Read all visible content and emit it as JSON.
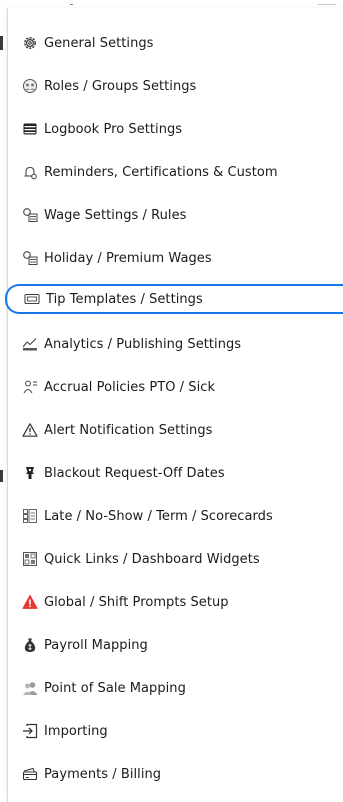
{
  "menu": {
    "items": [
      {
        "label": "General Settings",
        "icon": "gear-icon"
      },
      {
        "label": "Roles / Groups Settings",
        "icon": "group-globe-icon"
      },
      {
        "label": "Logbook Pro Settings",
        "icon": "logbook-icon"
      },
      {
        "label": "Reminders, Certifications & Custom",
        "icon": "bell-reminder-icon"
      },
      {
        "label": "Wage Settings / Rules",
        "icon": "wage-icon"
      },
      {
        "label": "Holiday / Premium Wages",
        "icon": "holiday-wage-icon"
      },
      {
        "label": "Tip Templates / Settings",
        "icon": "tip-card-icon",
        "selected": true
      },
      {
        "label": "Analytics / Publishing Settings",
        "icon": "analytics-chart-icon"
      },
      {
        "label": "Accrual Policies PTO / Sick",
        "icon": "accrual-icon"
      },
      {
        "label": "Alert Notification Settings",
        "icon": "warning-triangle-icon"
      },
      {
        "label": "Blackout Request-Off Dates",
        "icon": "blackout-icon"
      },
      {
        "label": "Late / No-Show / Term / Scorecards",
        "icon": "scorecard-icon"
      },
      {
        "label": "Quick Links / Dashboard Widgets",
        "icon": "dashboard-widget-icon"
      },
      {
        "label": "Global / Shift Prompts Setup",
        "icon": "red-alert-icon"
      },
      {
        "label": "Payroll Mapping",
        "icon": "money-bag-icon"
      },
      {
        "label": "Point of Sale Mapping",
        "icon": "people-icon"
      },
      {
        "label": "Importing",
        "icon": "import-icon"
      },
      {
        "label": "Payments / Billing",
        "icon": "payments-icon"
      }
    ]
  },
  "colors": {
    "selection_outline": "#1677e8",
    "alert_red": "#e53935"
  }
}
